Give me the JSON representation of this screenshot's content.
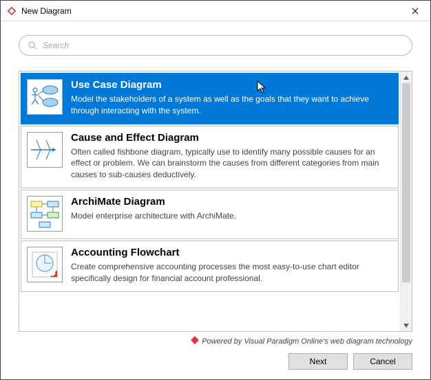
{
  "window": {
    "title": "New Diagram"
  },
  "search": {
    "placeholder": "Search",
    "value": ""
  },
  "list": {
    "selected_index": 0,
    "items": [
      {
        "title": "Use Case Diagram",
        "desc": "Model the stakeholders of a system as well as the goals that they want to achieve through interacting with the system.",
        "icon": "use-case"
      },
      {
        "title": "Cause and Effect Diagram",
        "desc": "Often called fishbone diagram, typically use to identify many possible causes for an effect or problem. We can brainstorm the causes from different categories from main causes to sub-causes deductively.",
        "icon": "fishbone"
      },
      {
        "title": "ArchiMate Diagram",
        "desc": "Model enterprise architecture with ArchiMate.",
        "icon": "archimate"
      },
      {
        "title": "Accounting Flowchart",
        "desc": "Create comprehensive accounting processes the most easy-to-use chart editor specifically design for financial account professional.",
        "icon": "accounting"
      }
    ]
  },
  "footer": {
    "note": "Powered by Visual Paradigm Online's web diagram technology"
  },
  "buttons": {
    "next": "Next",
    "cancel": "Cancel"
  }
}
